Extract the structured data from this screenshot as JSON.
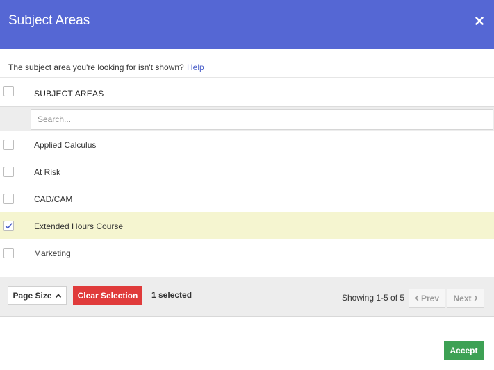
{
  "dialog": {
    "title": "Subject Areas",
    "close_icon": "close-icon",
    "header_color": "#5567d4"
  },
  "hint": {
    "text": "The subject area you're looking for isn't shown?",
    "link_label": "Help"
  },
  "table": {
    "column_header": "SUBJECT AREAS",
    "search_placeholder": "Search...",
    "search_value": "",
    "rows": [
      {
        "label": "Applied Calculus",
        "checked": false
      },
      {
        "label": "At Risk",
        "checked": false
      },
      {
        "label": "CAD/CAM",
        "checked": false
      },
      {
        "label": "Extended Hours Course",
        "checked": true
      },
      {
        "label": "Marketing",
        "checked": false
      }
    ]
  },
  "footer": {
    "page_size_label": "Page Size",
    "clear_label": "Clear Selection",
    "clear_color": "#e03b3b",
    "selected_count": "1 selected",
    "showing": "Showing 1-5 of 5",
    "prev_label": "Prev",
    "next_label": "Next"
  },
  "actions": {
    "accept_label": "Accept",
    "accept_color": "#3da154"
  }
}
